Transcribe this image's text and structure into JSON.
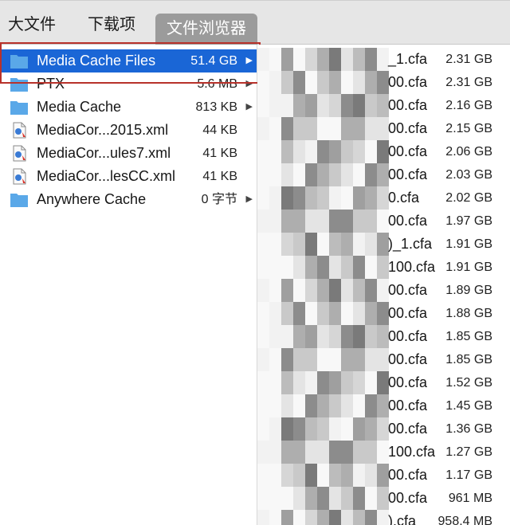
{
  "tabs": [
    {
      "label": "大文件"
    },
    {
      "label": "下载项"
    },
    {
      "label": "文件浏览器",
      "active": true
    }
  ],
  "left_items": [
    {
      "icon": "folder-icon",
      "name": "Media Cache Files",
      "size": "51.4 GB",
      "selected": true,
      "expandable": true
    },
    {
      "icon": "folder-icon",
      "name": "PTX",
      "size": "5.6 MB",
      "selected": false,
      "expandable": true
    },
    {
      "icon": "folder-icon",
      "name": "Media Cache",
      "size": "813 KB",
      "selected": false,
      "expandable": true
    },
    {
      "icon": "xml-file-icon",
      "name": "MediaCor...2015.xml",
      "size": "44 KB",
      "selected": false,
      "expandable": false
    },
    {
      "icon": "xml-file-icon",
      "name": "MediaCor...ules7.xml",
      "size": "41 KB",
      "selected": false,
      "expandable": false
    },
    {
      "icon": "xml-file-icon",
      "name": "MediaCor...lesCC.xml",
      "size": "41 KB",
      "selected": false,
      "expandable": false
    },
    {
      "icon": "folder-icon",
      "name": "Anywhere Cache",
      "size": "0 字节",
      "selected": false,
      "expandable": true
    }
  ],
  "right_items": [
    {
      "name": "_1.cfa",
      "size": "2.31 GB"
    },
    {
      "name": "00.cfa",
      "size": "2.31 GB"
    },
    {
      "name": "00.cfa",
      "size": "2.16 GB"
    },
    {
      "name": "00.cfa",
      "size": "2.15 GB"
    },
    {
      "name": "00.cfa",
      "size": "2.06 GB"
    },
    {
      "name": "00.cfa",
      "size": "2.03 GB"
    },
    {
      "name": "0.cfa",
      "size": "2.02 GB"
    },
    {
      "name": "00.cfa",
      "size": "1.97 GB"
    },
    {
      "name": ")_1.cfa",
      "size": "1.91 GB"
    },
    {
      "name": "100.cfa",
      "size": "1.91 GB"
    },
    {
      "name": "00.cfa",
      "size": "1.89 GB"
    },
    {
      "name": "00.cfa",
      "size": "1.88 GB"
    },
    {
      "name": "00.cfa",
      "size": "1.85 GB"
    },
    {
      "name": "00.cfa",
      "size": "1.85 GB"
    },
    {
      "name": "00.cfa",
      "size": "1.52 GB"
    },
    {
      "name": "00.cfa",
      "size": "1.45 GB"
    },
    {
      "name": "00.cfa",
      "size": "1.36 GB"
    },
    {
      "name": "100.cfa",
      "size": "1.27 GB"
    },
    {
      "name": "00.cfa",
      "size": "1.17 GB"
    },
    {
      "name": "00.cfa",
      "size": "961 MB"
    },
    {
      "name": ").cfa",
      "size": "958.4 MB"
    }
  ],
  "colors": {
    "selection": "#1a66d6",
    "highlight_box": "#b8322b",
    "folder": "#5aa8e8",
    "active_tab": "#9b9b9b"
  }
}
